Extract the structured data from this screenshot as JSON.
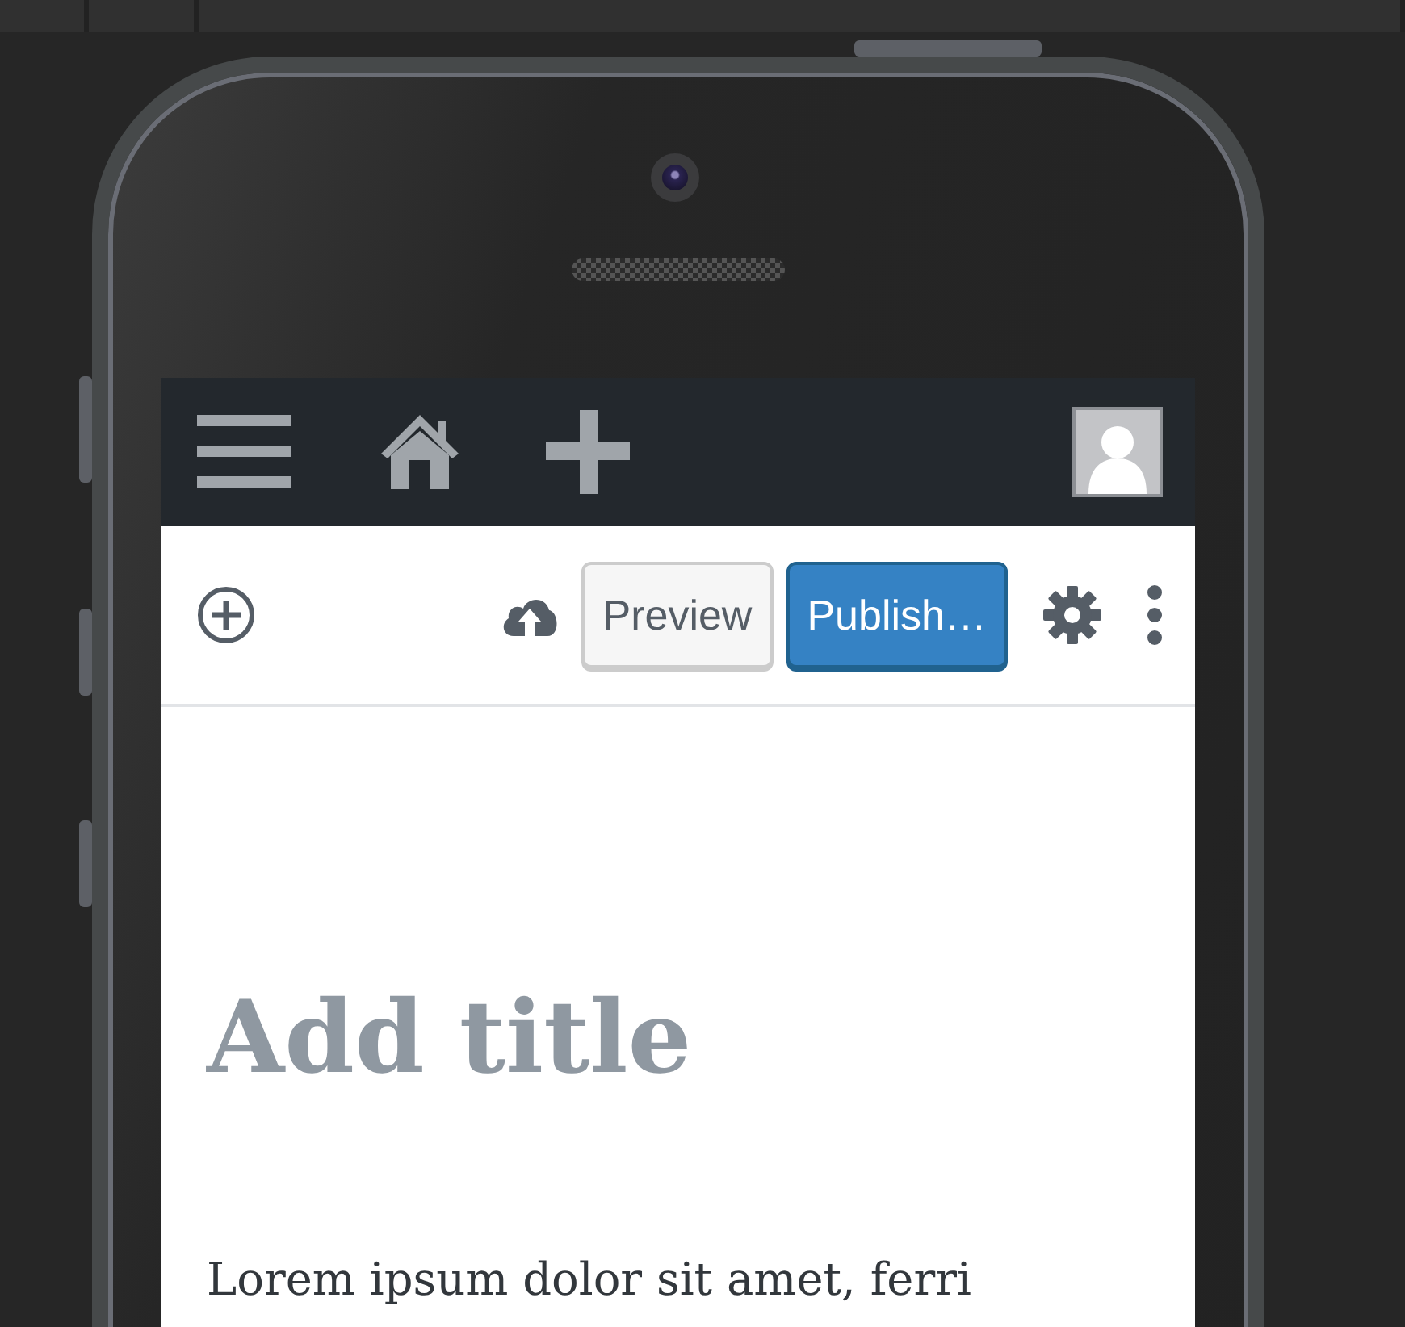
{
  "editor_toolbar": {
    "buttons": [
      {
        "kind": "secondary",
        "label": "Preview"
      },
      {
        "kind": "primary",
        "label": "Publish…"
      }
    ]
  },
  "title": {
    "placeholder": "Add title"
  },
  "paragraph": "Lorem ipsum dolor sit amet, ferri"
}
